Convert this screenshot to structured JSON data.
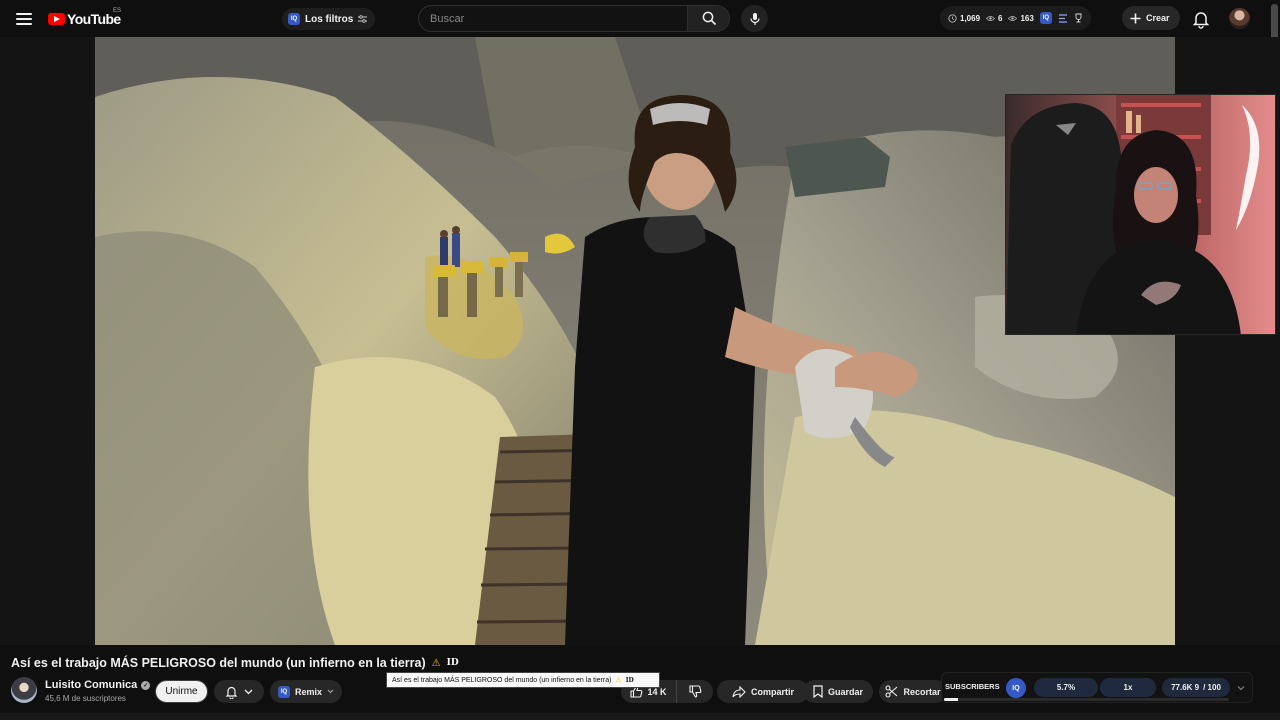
{
  "masthead": {
    "logo_text": "YouTube",
    "country": "ES",
    "filters_label": "Los filtros",
    "search_placeholder": "Buscar",
    "stats": [
      "1,069",
      "6",
      "163"
    ],
    "iq_badge": "IQ",
    "create_label": "Crear"
  },
  "video": {
    "title": "Así es el trabajo MÁS PELIGROSO del mundo (un infierno en la tierra)",
    "title_badge": "ID",
    "tooltip": "Así es el trabajo MÁS PELIGROSO del mundo (un infierno en la tierra)",
    "tooltip_badge": "ID"
  },
  "channel": {
    "name": "Luisito Comunica",
    "subscribers": "45,6 M de suscriptores",
    "join_label": "Unirme"
  },
  "actions": {
    "remix_label": "Remix",
    "like_count": "14 K",
    "share_label": "Compartir",
    "save_label": "Guardar",
    "clip_label": "Recortar"
  },
  "iq_panel": {
    "subscribers_label": "SUBSCRIBERS",
    "iq": "IQ",
    "percent": "5.7%",
    "speed": "1x",
    "score": "77.6K 9",
    "score_max": "/ 100",
    "progress": 0.05
  }
}
